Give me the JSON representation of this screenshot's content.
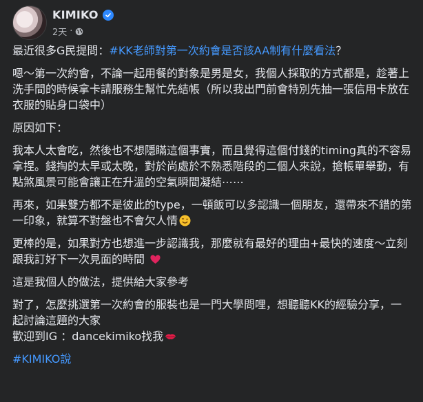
{
  "author": {
    "name": "KIMIKO",
    "time": "2天",
    "dot": "·"
  },
  "post": {
    "p1_text": "最近很多G民提問：",
    "p1_hashtag": "#KK老師對第一次約會是否該AA制有什麼看法",
    "p1_end": "？",
    "p2": "嗯～第一次約會，不論一起用餐的對象是男是女，我個人採取的方式都是，趁著上洗手間的時候拿卡請服務生幫忙先結帳（所以我出門前會特別先抽一張信用卡放在衣服的貼身口袋中）",
    "p3": "原因如下：",
    "p4": "我本人太會吃，然後也不想隱瞞這個事實，而且覺得這個付錢的timing真的不容易拿捏。錢掏的太早或太晚，對於尚處於不熟悉階段的二個人來說，搶帳單舉動，有點煞風景可能會讓正在升溫的空氣瞬間凝結⋯⋯",
    "p5": "再來，如果雙方都不是彼此的type，一頓飯可以多認識一個朋友，還帶來不錯的第一印象，就算不對盤也不會欠人情",
    "p6": "更棒的是，如果對方也想進一步認識我，那麼就有最好的理由+最快的速度～立刻跟我訂好下一次見面的時間",
    "p7": "這是我個人的做法，提供給大家參考",
    "p8a": "對了，怎麼挑選第一次約會的服裝也是一門大學問哩，想聽聽KK的經驗分享，一起討論這題的大家",
    "p8b": "歡迎到IG ：dancekimiko找我",
    "footer_hashtag": "#KIMIKO說"
  },
  "icons": {
    "verified": "verified-badge-icon",
    "globe": "globe-icon",
    "smile": "smiling-face-emoji",
    "heart": "red-heart-emoji",
    "lips": "kiss-mark-emoji"
  },
  "colors": {
    "background": "#242526",
    "text": "#e4e6eb",
    "secondary": "#b0b3b8",
    "hashtag": "#4599ff",
    "verified": "#2d88ff"
  }
}
